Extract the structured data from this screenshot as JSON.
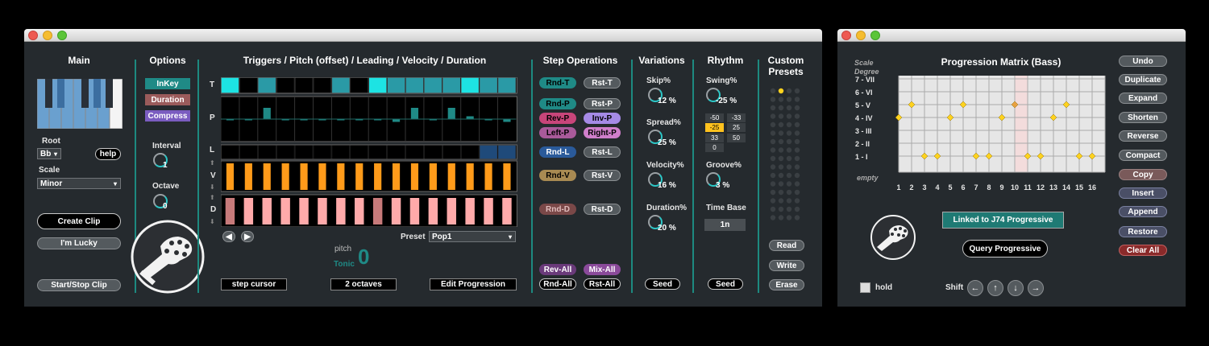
{
  "main": {
    "title": "Main",
    "root_label": "Root",
    "root_value": "Bb",
    "help_label": "help",
    "scale_label": "Scale",
    "scale_value": "Minor",
    "create_clip": "Create Clip",
    "im_lucky": "I'm Lucky",
    "start_stop": "Start/Stop Clip"
  },
  "options": {
    "title": "Options",
    "inkey": "InKey",
    "duration": "Duration",
    "compress": "Compress",
    "interval_label": "Interval",
    "interval_value": "1",
    "octave_label": "Octave",
    "octave_value": "0"
  },
  "triggers": {
    "title": "Triggers / Pitch (offset) / Leading / Velocity / Duration",
    "row_labels": {
      "t": "T",
      "p": "P",
      "l": "L",
      "v": "V",
      "d": "D"
    },
    "preset_label": "Preset",
    "preset_value": "Pop1",
    "pitch_label": "pitch",
    "tonic_label": "Tonic",
    "pitch_value": "0",
    "step_cursor": "step cursor",
    "octaves": "2 octaves",
    "edit_progression": "Edit Progression",
    "t_states": [
      1,
      0,
      2,
      0,
      0,
      0,
      2,
      0,
      1,
      2,
      2,
      2,
      2,
      1,
      2,
      2,
      0
    ],
    "p_offsets": [
      0,
      0,
      4,
      0,
      0,
      0,
      0,
      0,
      0,
      -1,
      4,
      0,
      4,
      1,
      0,
      -1,
      0
    ],
    "l_states": [
      0,
      0,
      0,
      0,
      0,
      0,
      0,
      0,
      0,
      0,
      0,
      0,
      0,
      0,
      1,
      1,
      0
    ],
    "v_dark": [
      0,
      0,
      0,
      0,
      0,
      0,
      0,
      0,
      0,
      0,
      0,
      0,
      0,
      0,
      0,
      0
    ],
    "d_dark": [
      1,
      0,
      0,
      0,
      0,
      0,
      0,
      0,
      1,
      0,
      0,
      0,
      0,
      0,
      0,
      0
    ]
  },
  "step_ops": {
    "title": "Step Operations",
    "rnd_t": "Rnd-T",
    "rst_t": "Rst-T",
    "rnd_p": "Rnd-P",
    "rst_p": "Rst-P",
    "rev_p": "Rev-P",
    "inv_p": "Inv-P",
    "left_p": "Left-P",
    "right_p": "Right-P",
    "rnd_l": "Rnd-L",
    "rst_l": "Rst-L",
    "rnd_v": "Rnd-V",
    "rst_v": "Rst-V",
    "rnd_d": "Rnd-D",
    "rst_d": "Rst-D",
    "rev_all": "Rev-All",
    "mix_all": "Mix-All",
    "rnd_all": "Rnd-All",
    "rst_all": "Rst-All"
  },
  "variations": {
    "title": "Variations",
    "skip_label": "Skip%",
    "skip_value": "12 %",
    "spread_label": "Spread%",
    "spread_value": "25 %",
    "velocity_label": "Velocity%",
    "velocity_value": "16 %",
    "duration_label": "Duration%",
    "duration_value": "20 %",
    "seed": "Seed"
  },
  "rhythm": {
    "title": "Rhythm",
    "swing_label": "Swing%",
    "swing_value": "-25 %",
    "grid": [
      "-50",
      "-33",
      "-25",
      "25",
      "33",
      "50",
      "0"
    ],
    "groove_label": "Groove%",
    "groove_value": "3 %",
    "timebase_label": "Time Base",
    "timebase_value": "1n",
    "seed": "Seed"
  },
  "custom_presets": {
    "title1": "Custom",
    "title2": "Presets",
    "read": "Read",
    "write": "Write",
    "erase": "Erase"
  },
  "matrix": {
    "title": "Progression Matrix (Bass)",
    "scale_degree_1": "Scale",
    "scale_degree_2": "Degree",
    "degrees": [
      "7 - VII",
      "6 - VI",
      "5 - V",
      "4 - IV",
      "3 - III",
      "2 - II",
      "1 - I"
    ],
    "empty_label": "empty",
    "columns": [
      "1",
      "2",
      "3",
      "4",
      "5",
      "6",
      "7",
      "8",
      "9",
      "10",
      "11",
      "12",
      "13",
      "14",
      "15",
      "16"
    ],
    "points": [
      4,
      5,
      1,
      1,
      4,
      5,
      1,
      1,
      4,
      5,
      1,
      1,
      4,
      5,
      1,
      1
    ],
    "linked": "Linked to J74 Progressive",
    "query": "Query Progressive",
    "hold_label": "hold",
    "shift_label": "Shift"
  },
  "matrix_buttons": {
    "undo": "Undo",
    "duplicate": "Duplicate",
    "expand": "Expand",
    "shorten": "Shorten",
    "reverse": "Reverse",
    "compact": "Compact",
    "copy": "Copy",
    "insert": "Insert",
    "append": "Append",
    "restore": "Restore",
    "clear_all": "Clear All"
  },
  "colors": {
    "teal": "#1f8a86",
    "cyan": "#1de3e3",
    "orange": "#ff9b1a",
    "pink": "#ffaaaa",
    "yellow_dot": "#ffd21e",
    "purple": "#8f5fcf",
    "brown": "#9a5b5b"
  }
}
